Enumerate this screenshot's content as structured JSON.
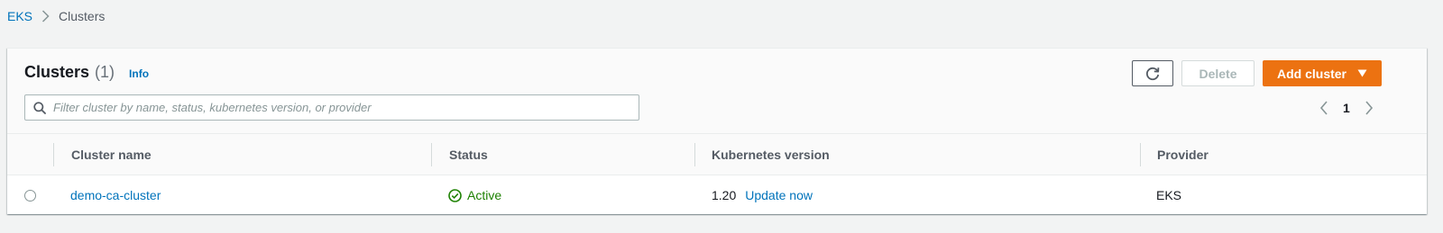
{
  "breadcrumb": {
    "root": "EKS",
    "current": "Clusters"
  },
  "header": {
    "title": "Clusters",
    "count": "(1)",
    "info": "Info"
  },
  "toolbar": {
    "delete_label": "Delete",
    "add_label": "Add cluster"
  },
  "search": {
    "placeholder": "Filter cluster by name, status, kubernetes version, or provider",
    "value": ""
  },
  "pagination": {
    "page": "1"
  },
  "table": {
    "columns": [
      "Cluster name",
      "Status",
      "Kubernetes version",
      "Provider"
    ],
    "rows": [
      {
        "name": "demo-ca-cluster",
        "status": "Active",
        "version": "1.20",
        "update_link": "Update now",
        "provider": "EKS"
      }
    ]
  },
  "colors": {
    "link": "#0073bb",
    "primary_button": "#ec7211",
    "status_active": "#1d8102",
    "page_background": "#f2f3f3"
  },
  "icons": {
    "breadcrumb_separator": "chevron-right-icon",
    "search": "search-icon",
    "refresh": "refresh-icon",
    "dropdown": "caret-down-icon",
    "prev_page": "chevron-left-icon",
    "next_page": "chevron-right-icon",
    "status": "check-circle-icon"
  }
}
